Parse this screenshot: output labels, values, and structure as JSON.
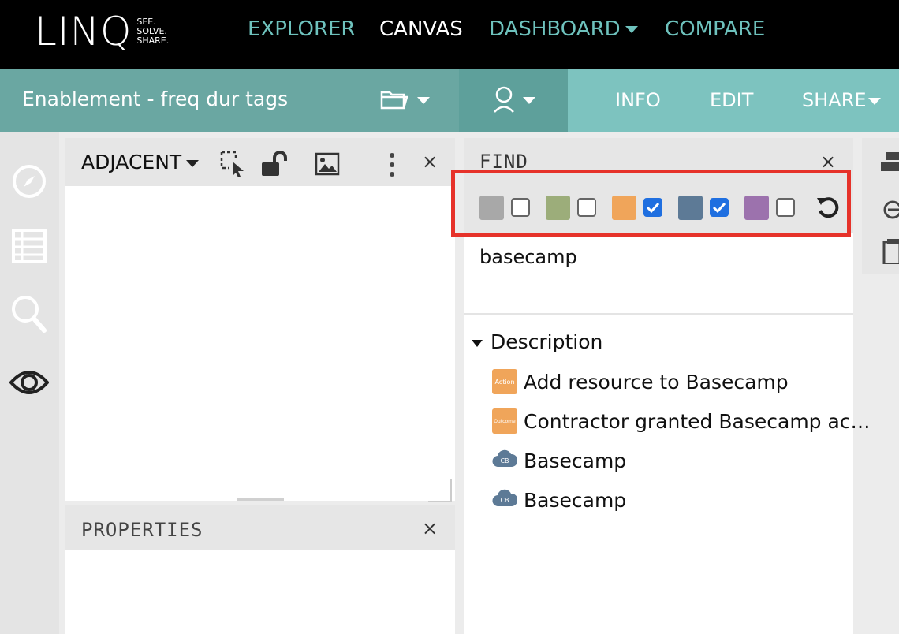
{
  "brand": {
    "logo_text": "LINQ",
    "tagline_1": "SEE.",
    "tagline_2": "SOLVE.",
    "tagline_3": "SHARE."
  },
  "nav": {
    "explorer": "EXPLORER",
    "canvas": "CANVAS",
    "dashboard": "DASHBOARD",
    "compare": "COMPARE"
  },
  "secondary": {
    "title": "Enablement - freq dur tags",
    "info": "INFO",
    "edit": "EDIT",
    "share": "SHARE"
  },
  "adjacent": {
    "title": "ADJACENT",
    "close": "×"
  },
  "find": {
    "title": "FIND",
    "close": "×",
    "filters": [
      {
        "color": "#a8a8a8",
        "checked": false
      },
      {
        "color": "#9cad7a",
        "checked": false
      },
      {
        "color": "#f0a55a",
        "checked": true
      },
      {
        "color": "#5d7a96",
        "checked": true
      },
      {
        "color": "#9c72ad",
        "checked": false
      }
    ],
    "search_term": "basecamp",
    "section": "Description",
    "results": [
      {
        "label": "Add resource to Basecamp",
        "badge": "Action"
      },
      {
        "label": "Contractor granted Basecamp ac…",
        "badge": "Outcome"
      },
      {
        "label": "Basecamp",
        "badge": "CB"
      },
      {
        "label": "Basecamp",
        "badge": "CB"
      }
    ]
  },
  "properties": {
    "title": "PROPERTIES",
    "close": "×"
  },
  "colors": {
    "top_bar": "#000000",
    "accent_teal": "#6ec2bd",
    "secondary_bar": "#7dc3bf",
    "highlight_red": "#e6322a",
    "checkbox_blue": "#1f6fe0"
  }
}
